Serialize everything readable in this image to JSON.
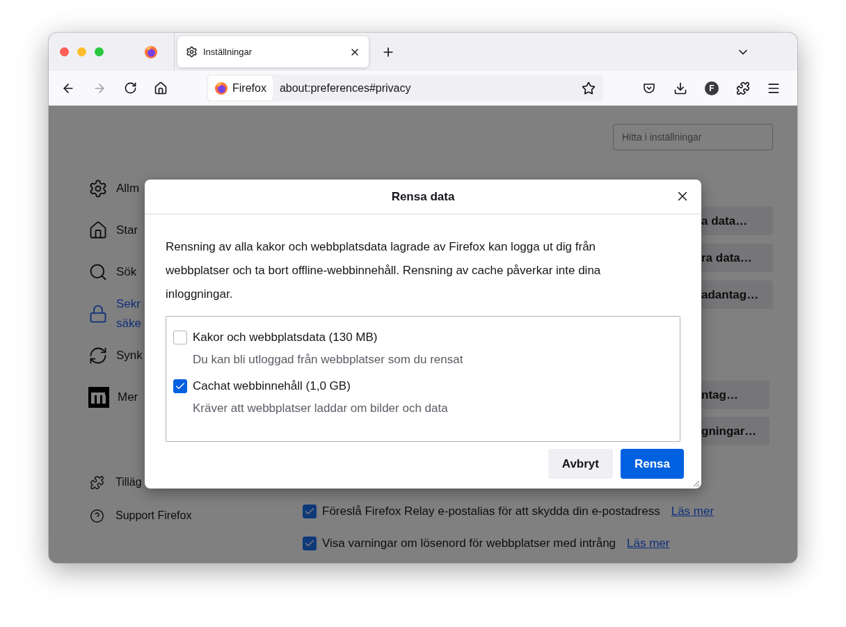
{
  "tabs": [
    {
      "kind": "pinned",
      "selected": false
    },
    {
      "kind": "labeled",
      "label": "Inställningar",
      "selected": true
    }
  ],
  "toolbar": {
    "identity_label": "Firefox",
    "url": "about:preferences#privacy",
    "account_initial": "F"
  },
  "search": {
    "placeholder": "Hitta i inställningar"
  },
  "sidebar": {
    "items": [
      {
        "lines": [
          "Allm"
        ],
        "selected": false
      },
      {
        "lines": [
          "Star"
        ],
        "selected": false
      },
      {
        "lines": [
          "Sök"
        ],
        "selected": false
      },
      {
        "lines": [
          "Sekr",
          "säke"
        ],
        "selected": true
      },
      {
        "lines": [
          "Synk"
        ],
        "selected": false
      },
      {
        "lines": [
          "Mer"
        ],
        "selected": false
      }
    ],
    "footer_items": [
      {
        "label": "Tilläg"
      },
      {
        "label": "Support Firefox"
      }
    ]
  },
  "right_buttons": [
    {
      "label": "a data…"
    },
    {
      "label": "ra data…"
    },
    {
      "label": "adantag…"
    },
    {
      "label": "ntag…"
    },
    {
      "label": "gningar…"
    }
  ],
  "options": [
    {
      "label": "Föreslå Firefox Relay e-postalias för att skydda din e-postadress",
      "checked": true,
      "link": "Läs mer"
    },
    {
      "label": "Visa varningar om lösenord för webbplatser med intrång",
      "checked": true,
      "link": "Läs mer"
    }
  ],
  "dialog": {
    "title": "Rensa data",
    "description": "Rensning av alla kakor och webbplatsdata lagrade av Firefox kan logga ut dig från webbplatser och ta bort offline-webbinnehåll. Rensning av cache påverkar inte dina inloggningar.",
    "items": [
      {
        "label": "Kakor och webbplatsdata (130 MB)",
        "description": "Du kan bli utloggad från webbplatser som du rensat",
        "checked": false
      },
      {
        "label": "Cachat webbinnehåll (1,0 GB)",
        "description": "Kräver att webbplatser laddar om bilder och data",
        "checked": true
      }
    ],
    "buttons": [
      {
        "label": "Avbryt",
        "kind": "secondary"
      },
      {
        "label": "Rensa",
        "kind": "primary"
      }
    ]
  }
}
